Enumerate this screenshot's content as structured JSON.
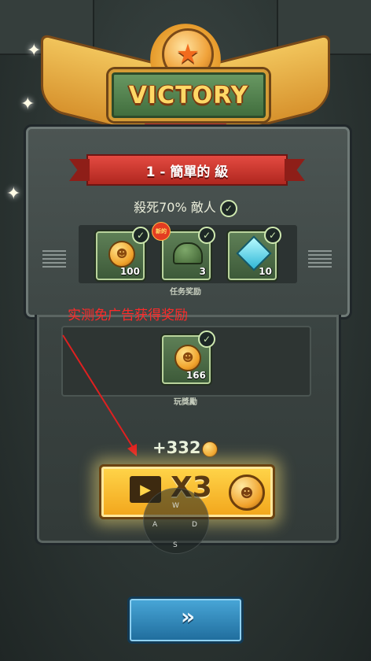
{
  "header": {
    "title": "VICTORY"
  },
  "level": {
    "label": "1 - 簡單的 級"
  },
  "objective": {
    "text": "殺死70% 敵人"
  },
  "mission_rewards": {
    "caption": "任务奖励",
    "new_badge": "新的",
    "items": [
      {
        "name": "coin",
        "count": "100"
      },
      {
        "name": "helmet",
        "count": "3"
      },
      {
        "name": "gem",
        "count": "10"
      }
    ]
  },
  "annotation": {
    "text": "实测免广告获得奖励"
  },
  "play_rewards": {
    "caption": "玩獎勵",
    "items": [
      {
        "name": "coin",
        "count": "166"
      }
    ]
  },
  "total": {
    "gain": "+332"
  },
  "multiplier_button": {
    "label": "X3"
  },
  "joystick": {
    "up": "W",
    "left": "A",
    "right": "D",
    "down": "S"
  },
  "next_button": {
    "label": "»"
  },
  "colors": {
    "accent": "#f2a51b",
    "victory_green": "#3f6c3c",
    "banner_red": "#b0271f",
    "next_blue": "#1f6c9c"
  }
}
